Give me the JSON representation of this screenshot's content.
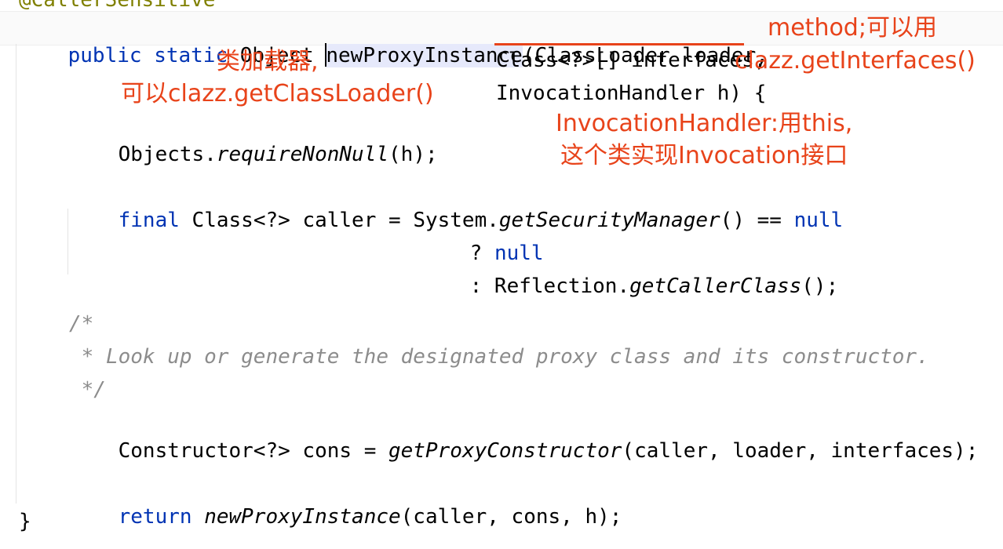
{
  "code": {
    "annotation_top": "@CallerSensitive",
    "sig": {
      "modifiers": "public static ",
      "return_type": "Object ",
      "method_name": "newProxyInstance",
      "param1": "(ClassLoader loader,",
      "param2": "Class<?>[] interfaces,",
      "param3": "InvocationHandler h) {"
    },
    "l_requirenonnull": {
      "a": "Objects.",
      "b": "requireNonNull",
      "c": "(h);"
    },
    "l_caller": {
      "kw": "final",
      "a": " Class<?> caller = System.",
      "b": "getSecurityManager",
      "c": "() == ",
      "kw2": "null"
    },
    "l_ternary1": {
      "a": "? ",
      "kw": "null"
    },
    "l_ternary2": {
      "a": ": Reflection.",
      "b": "getCallerClass",
      "c": "();"
    },
    "comment": {
      "open": "/*",
      "body": " * Look up or generate the designated proxy class and its constructor.",
      "close": " */"
    },
    "l_cons": {
      "a": "Constructor<?> cons = ",
      "b": "getProxyConstructor",
      "c": "(caller, loader, interfaces);"
    },
    "l_return": {
      "kw": "return",
      "a": " ",
      "b": "newProxyInstance",
      "c": "(caller, cons, h);"
    },
    "close_brace": "}"
  },
  "notes": {
    "loader_line1": "类加载器,",
    "loader_line2": "可以clazz.getClassLoader()",
    "interfaces_line1": "method;可以用",
    "interfaces_line2": "clazz.getInterfaces()",
    "handler_line1": "InvocationHandler:用this,",
    "handler_line2": "这个类实现Invocation接口"
  },
  "colors": {
    "keyword": "#0033b3",
    "annotation": "#808000",
    "comment": "#8c8c8c",
    "note_red": "#e8431a",
    "method_highlight": "#e6e9fb"
  }
}
